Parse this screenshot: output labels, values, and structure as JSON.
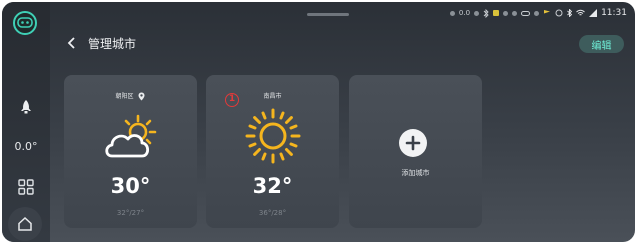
{
  "sidebar": {
    "temperature": "0.0°"
  },
  "status_bar": {
    "signal_text": "0.0",
    "time": "11:31"
  },
  "header": {
    "title": "管理城市",
    "edit_label": "编辑"
  },
  "cards": [
    {
      "city": "朝阳区",
      "temp": "30°",
      "range": "32°/27°",
      "icon": "partly-cloudy-icon"
    },
    {
      "city": "南昌市",
      "temp": "32°",
      "range": "36°/28°",
      "icon": "sunny-icon",
      "badge": "1"
    }
  ],
  "add_card": {
    "label": "添加城市"
  },
  "colors": {
    "accent": "#6ff0d8",
    "sun": "#f5b51e",
    "badge": "#e23a3a"
  }
}
